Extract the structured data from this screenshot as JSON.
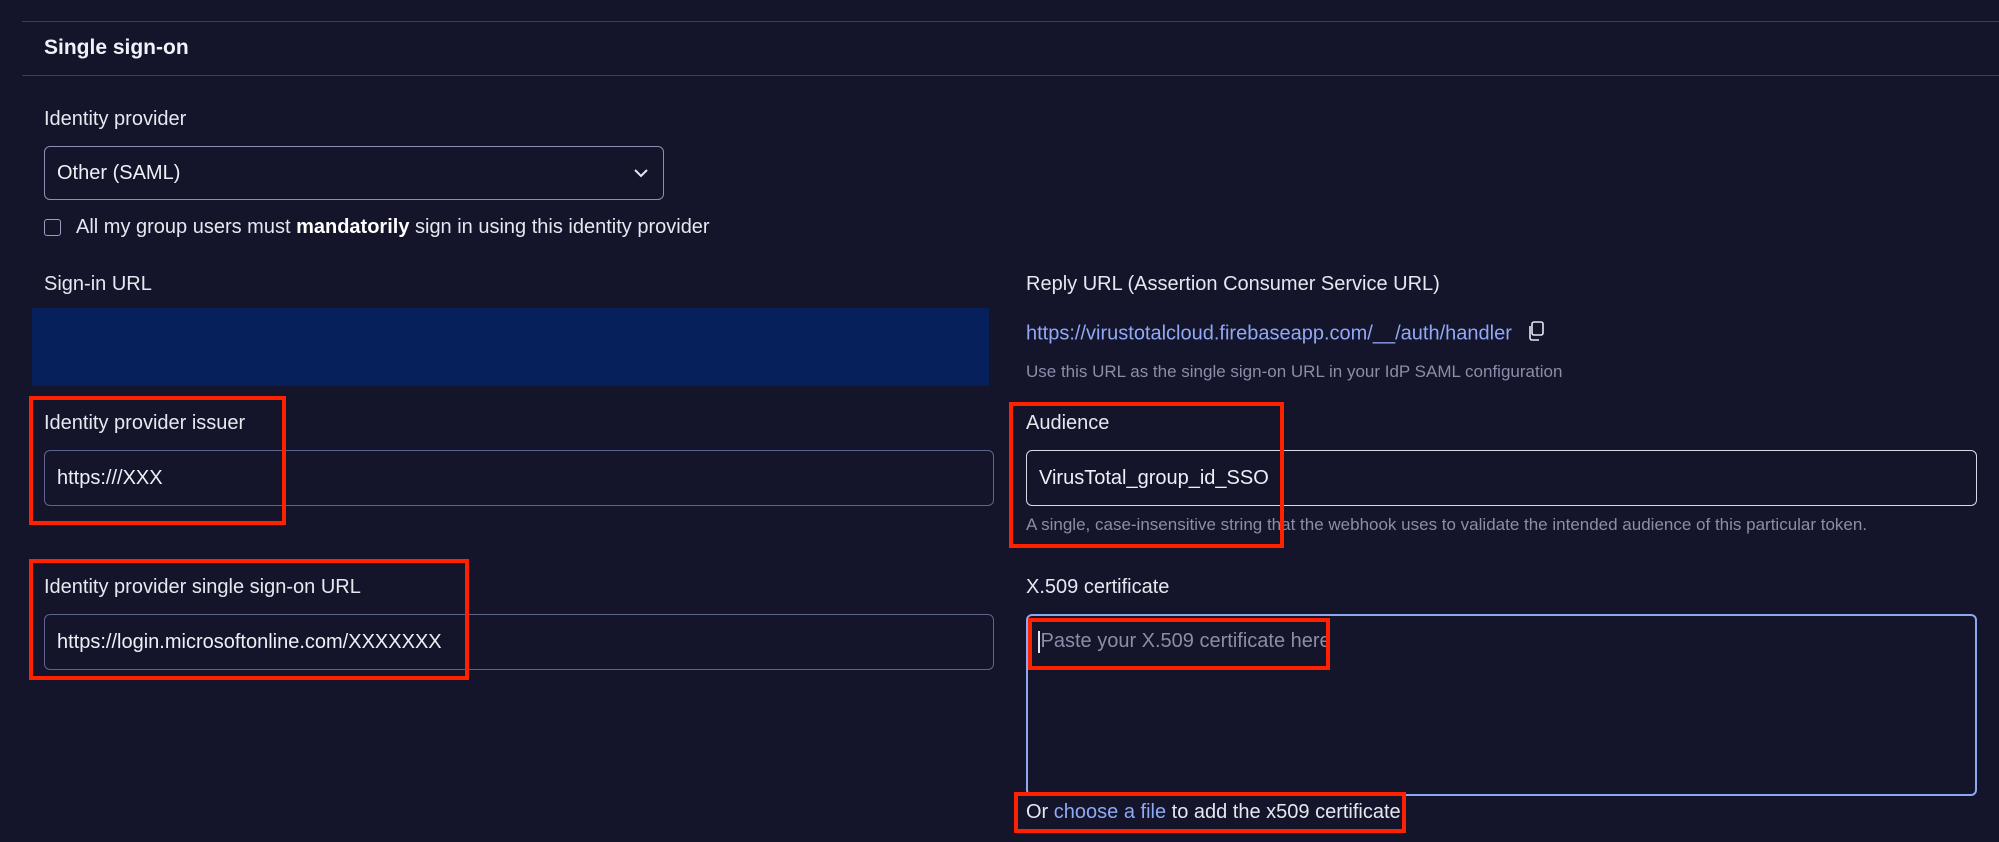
{
  "section": {
    "title": "Single sign-on"
  },
  "identity_provider": {
    "label": "Identity provider",
    "selected": "Other (SAML)",
    "checkbox_checked": false,
    "checkbox_pre": "All my group users must ",
    "checkbox_bold": "mandatorily",
    "checkbox_post": " sign in using this identity provider"
  },
  "sign_in_url": {
    "label": "Sign-in URL"
  },
  "reply_url": {
    "label": "Reply URL (Assertion Consumer Service URL)",
    "url": "https://virustotalcloud.firebaseapp.com/__/auth/handler",
    "help": "Use this URL as the single sign-on URL in your IdP SAML configuration"
  },
  "issuer": {
    "label": "Identity provider issuer",
    "value": "https:///XXX"
  },
  "audience": {
    "label": "Audience",
    "value": "VirusTotal_group_id_SSO",
    "help": "A single, case-insensitive string that the webhook uses to validate the intended audience of this particular token."
  },
  "sso_url": {
    "label": "Identity provider single sign-on URL",
    "value": "https://login.microsoftonline.com/XXXXXXX"
  },
  "certificate": {
    "label": "X.509 certificate",
    "placeholder": "Paste your X.509 certificate here",
    "or_text": "Or ",
    "choose_link": "choose a file",
    "suffix": " to add the x509 certificate"
  },
  "icons": {
    "select_arrow": "chevron-down-icon",
    "copy": "copy-icon"
  },
  "colors": {
    "background": "#14142a",
    "link": "#8fa9f5",
    "highlight": "#ff2200",
    "redacted_block": "#05205a"
  }
}
